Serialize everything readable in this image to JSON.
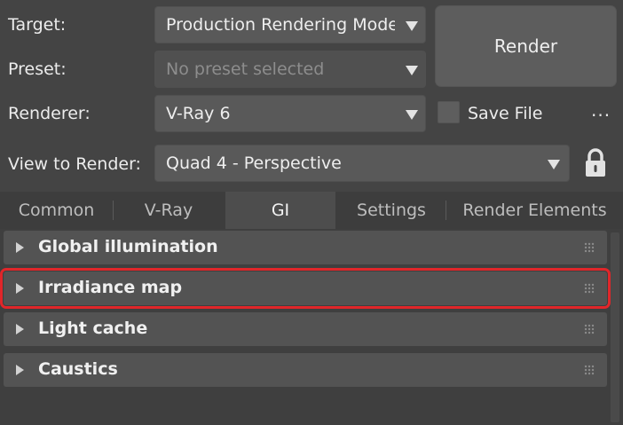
{
  "labels": {
    "target": "Target:",
    "preset": "Preset:",
    "renderer": "Renderer:",
    "view_to_render": "View to Render:"
  },
  "dropdowns": {
    "target": "Production Rendering Mode",
    "preset": "No preset selected",
    "renderer": "V-Ray 6",
    "view": "Quad 4 - Perspective"
  },
  "render_button": "Render",
  "save_file": "Save File",
  "more": "...",
  "tabs": [
    {
      "label": "Common"
    },
    {
      "label": "V-Ray"
    },
    {
      "label": "GI"
    },
    {
      "label": "Settings"
    },
    {
      "label": "Render Elements"
    }
  ],
  "active_tab": "GI",
  "rollouts": [
    {
      "title": "Global illumination"
    },
    {
      "title": "Irradiance map"
    },
    {
      "title": "Light cache"
    },
    {
      "title": "Caustics"
    }
  ],
  "icons": {
    "lock": "lock-icon",
    "arrow": "chevron-down-icon",
    "expand": "triangle-right-icon",
    "grip": "drag-grip-icon"
  },
  "colors": {
    "highlight": "#e0262a"
  }
}
